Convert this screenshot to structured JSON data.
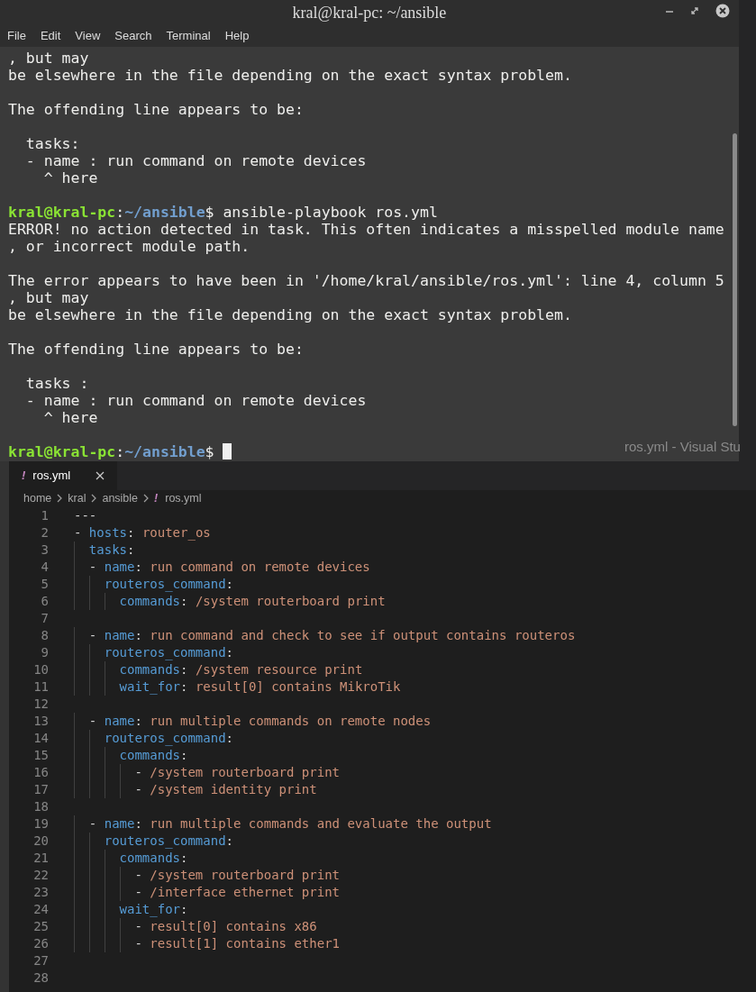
{
  "terminal": {
    "title": "kral@kral-pc: ~/ansible",
    "menu": [
      "File",
      "Edit",
      "View",
      "Search",
      "Terminal",
      "Help"
    ],
    "lines": [
      {
        "kind": "text",
        "segments": [
          {
            "kind": "plain",
            "text": ", but may"
          }
        ]
      },
      {
        "kind": "text",
        "segments": [
          {
            "kind": "plain",
            "text": "be elsewhere in the file depending on the exact syntax problem."
          }
        ]
      },
      {
        "kind": "blank"
      },
      {
        "kind": "text",
        "segments": [
          {
            "kind": "plain",
            "text": "The offending line appears to be:"
          }
        ]
      },
      {
        "kind": "blank"
      },
      {
        "kind": "text",
        "segments": [
          {
            "kind": "plain",
            "text": "  tasks:"
          }
        ]
      },
      {
        "kind": "text",
        "segments": [
          {
            "kind": "plain",
            "text": "  - name : run command on remote devices"
          }
        ]
      },
      {
        "kind": "text",
        "segments": [
          {
            "kind": "plain",
            "text": "    ^ here"
          }
        ]
      },
      {
        "kind": "blank"
      },
      {
        "kind": "text",
        "segments": [
          {
            "kind": "user",
            "text": "kral@kral-pc"
          },
          {
            "kind": "plain",
            "text": ":"
          },
          {
            "kind": "path",
            "text": "~/ansible"
          },
          {
            "kind": "plain",
            "text": "$ ansible-playbook ros.yml"
          }
        ]
      },
      {
        "kind": "text",
        "segments": [
          {
            "kind": "plain",
            "text": "ERROR! no action detected in task. This often indicates a misspelled module name"
          }
        ]
      },
      {
        "kind": "text",
        "segments": [
          {
            "kind": "plain",
            "text": ", or incorrect module path."
          }
        ]
      },
      {
        "kind": "blank"
      },
      {
        "kind": "text",
        "segments": [
          {
            "kind": "plain",
            "text": "The error appears to have been in '/home/kral/ansible/ros.yml': line 4, column 5"
          }
        ]
      },
      {
        "kind": "text",
        "segments": [
          {
            "kind": "plain",
            "text": ", but may"
          }
        ]
      },
      {
        "kind": "text",
        "segments": [
          {
            "kind": "plain",
            "text": "be elsewhere in the file depending on the exact syntax problem."
          }
        ]
      },
      {
        "kind": "blank"
      },
      {
        "kind": "text",
        "segments": [
          {
            "kind": "plain",
            "text": "The offending line appears to be:"
          }
        ]
      },
      {
        "kind": "blank"
      },
      {
        "kind": "text",
        "segments": [
          {
            "kind": "plain",
            "text": "  tasks :"
          }
        ]
      },
      {
        "kind": "text",
        "segments": [
          {
            "kind": "plain",
            "text": "  - name : run command on remote devices"
          }
        ]
      },
      {
        "kind": "text",
        "segments": [
          {
            "kind": "plain",
            "text": "    ^ here"
          }
        ]
      },
      {
        "kind": "blank"
      },
      {
        "kind": "text",
        "segments": [
          {
            "kind": "user",
            "text": "kral@kral-pc"
          },
          {
            "kind": "plain",
            "text": ":"
          },
          {
            "kind": "path",
            "text": "~/ansible"
          },
          {
            "kind": "plain",
            "text": "$ "
          }
        ],
        "cursor": true
      }
    ]
  },
  "background_window_title": "ros.yml - Visual Stu",
  "editor": {
    "tabs": [
      {
        "icon": "!",
        "label": "ros.yml",
        "selected": true
      }
    ],
    "breadcrumbs": [
      {
        "label": "home"
      },
      {
        "label": "kral"
      },
      {
        "label": "ansible"
      },
      {
        "icon": "!",
        "label": "ros.yml"
      }
    ],
    "lines": [
      {
        "number": "1",
        "tokens": [
          {
            "kind": "plain",
            "text": "---"
          }
        ]
      },
      {
        "number": "2",
        "tokens": [
          {
            "kind": "plain",
            "text": "- "
          },
          {
            "kind": "key",
            "text": "hosts"
          },
          {
            "kind": "plain",
            "text": ": "
          },
          {
            "kind": "value",
            "text": "router_os"
          }
        ]
      },
      {
        "number": "3",
        "tokens": [
          {
            "kind": "key",
            "text": "  tasks"
          },
          {
            "kind": "plain",
            "text": ":"
          }
        ]
      },
      {
        "number": "4",
        "tokens": [
          {
            "kind": "plain",
            "text": "  - "
          },
          {
            "kind": "key",
            "text": "name"
          },
          {
            "kind": "plain",
            "text": ": "
          },
          {
            "kind": "value",
            "text": "run command on remote devices"
          }
        ]
      },
      {
        "number": "5",
        "tokens": [
          {
            "kind": "key",
            "text": "    routeros_command"
          },
          {
            "kind": "plain",
            "text": ":"
          }
        ]
      },
      {
        "number": "6",
        "tokens": [
          {
            "kind": "key",
            "text": "      commands"
          },
          {
            "kind": "plain",
            "text": ": "
          },
          {
            "kind": "value",
            "text": "/system routerboard print"
          }
        ]
      },
      {
        "number": "7"
      },
      {
        "number": "8",
        "tokens": [
          {
            "kind": "plain",
            "text": "  - "
          },
          {
            "kind": "key",
            "text": "name"
          },
          {
            "kind": "plain",
            "text": ": "
          },
          {
            "kind": "value",
            "text": "run command and check to see if output contains routeros"
          }
        ]
      },
      {
        "number": "9",
        "tokens": [
          {
            "kind": "key",
            "text": "    routeros_command"
          },
          {
            "kind": "plain",
            "text": ":"
          }
        ]
      },
      {
        "number": "10",
        "tokens": [
          {
            "kind": "key",
            "text": "      commands"
          },
          {
            "kind": "plain",
            "text": ": "
          },
          {
            "kind": "value",
            "text": "/system resource print"
          }
        ]
      },
      {
        "number": "11",
        "tokens": [
          {
            "kind": "key",
            "text": "      wait_for"
          },
          {
            "kind": "plain",
            "text": ": "
          },
          {
            "kind": "value",
            "text": "result[0] contains MikroTik"
          }
        ]
      },
      {
        "number": "12"
      },
      {
        "number": "13",
        "tokens": [
          {
            "kind": "plain",
            "text": "  - "
          },
          {
            "kind": "key",
            "text": "name"
          },
          {
            "kind": "plain",
            "text": ": "
          },
          {
            "kind": "value",
            "text": "run multiple commands on remote nodes"
          }
        ]
      },
      {
        "number": "14",
        "tokens": [
          {
            "kind": "key",
            "text": "    routeros_command"
          },
          {
            "kind": "plain",
            "text": ":"
          }
        ]
      },
      {
        "number": "15",
        "tokens": [
          {
            "kind": "key",
            "text": "      commands"
          },
          {
            "kind": "plain",
            "text": ":"
          }
        ]
      },
      {
        "number": "16",
        "tokens": [
          {
            "kind": "plain",
            "text": "        - "
          },
          {
            "kind": "value",
            "text": "/system routerboard print"
          }
        ]
      },
      {
        "number": "17",
        "tokens": [
          {
            "kind": "plain",
            "text": "        - "
          },
          {
            "kind": "value",
            "text": "/system identity print"
          }
        ]
      },
      {
        "number": "18"
      },
      {
        "number": "19",
        "tokens": [
          {
            "kind": "plain",
            "text": "  - "
          },
          {
            "kind": "key",
            "text": "name"
          },
          {
            "kind": "plain",
            "text": ": "
          },
          {
            "kind": "value",
            "text": "run multiple commands and evaluate the output"
          }
        ]
      },
      {
        "number": "20",
        "tokens": [
          {
            "kind": "key",
            "text": "    routeros_command"
          },
          {
            "kind": "plain",
            "text": ":"
          }
        ]
      },
      {
        "number": "21",
        "tokens": [
          {
            "kind": "key",
            "text": "      commands"
          },
          {
            "kind": "plain",
            "text": ":"
          }
        ]
      },
      {
        "number": "22",
        "tokens": [
          {
            "kind": "plain",
            "text": "        - "
          },
          {
            "kind": "value",
            "text": "/system routerboard print"
          }
        ]
      },
      {
        "number": "23",
        "tokens": [
          {
            "kind": "plain",
            "text": "        - "
          },
          {
            "kind": "value",
            "text": "/interface ethernet print"
          }
        ]
      },
      {
        "number": "24",
        "tokens": [
          {
            "kind": "key",
            "text": "      wait_for"
          },
          {
            "kind": "plain",
            "text": ":"
          }
        ]
      },
      {
        "number": "25",
        "tokens": [
          {
            "kind": "plain",
            "text": "        - "
          },
          {
            "kind": "value",
            "text": "result[0] contains x86"
          }
        ]
      },
      {
        "number": "26",
        "tokens": [
          {
            "kind": "plain",
            "text": "        - "
          },
          {
            "kind": "value",
            "text": "result[1] contains ether1"
          }
        ]
      },
      {
        "number": "27"
      },
      {
        "number": "28"
      }
    ]
  }
}
